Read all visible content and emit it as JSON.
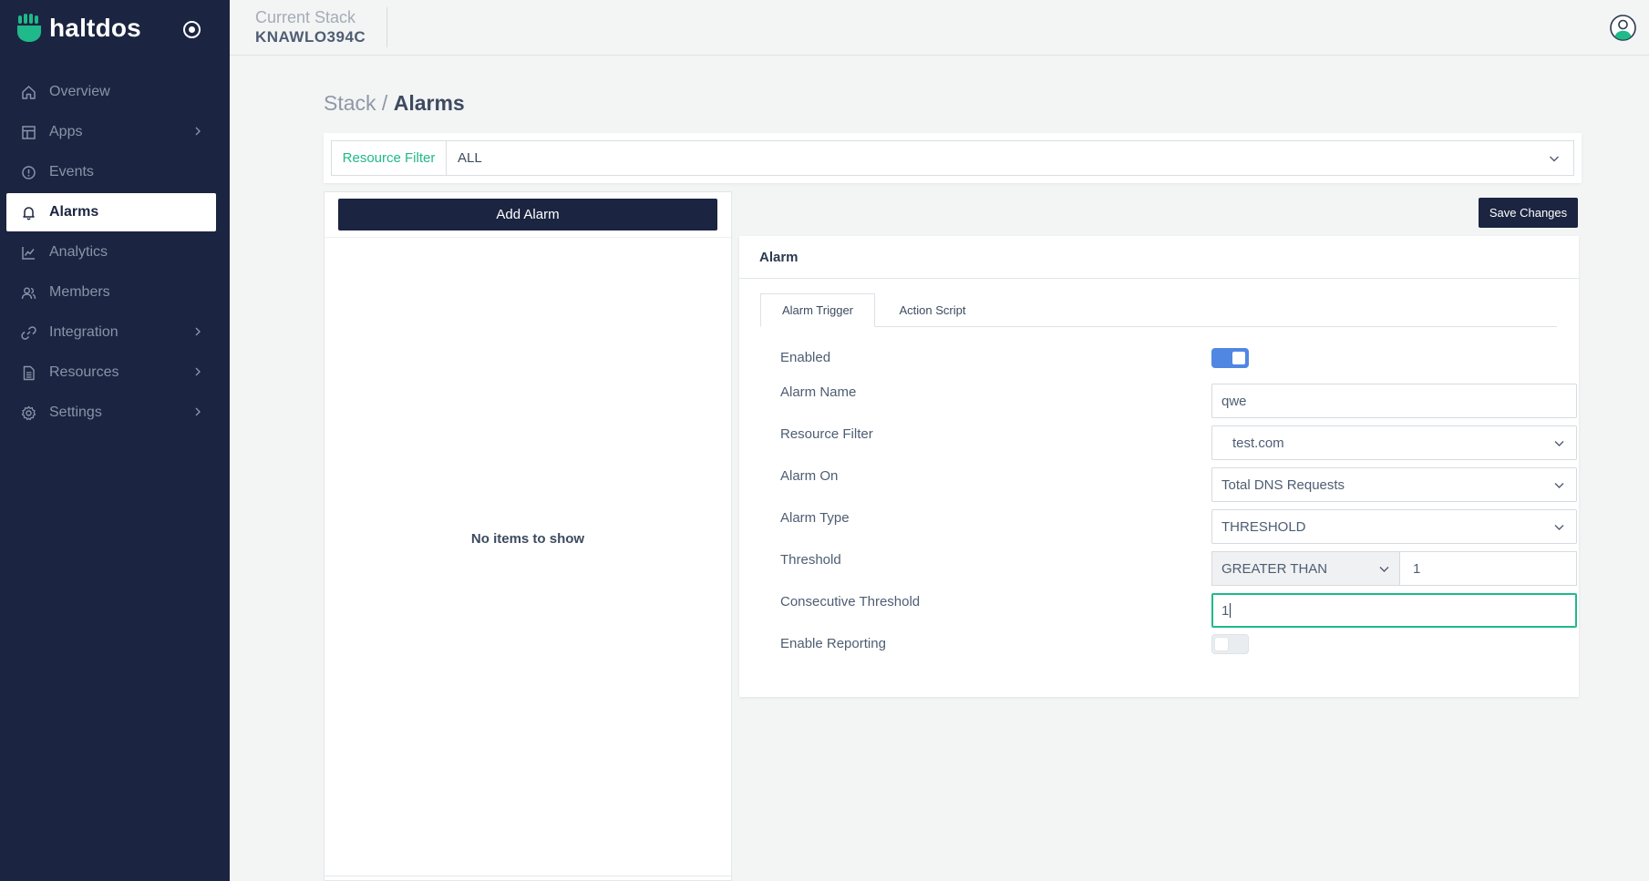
{
  "app": {
    "brand": "haltdos"
  },
  "sidebar": {
    "items": [
      {
        "label": "Overview",
        "icon": "home-icon",
        "has_chevron": false,
        "active": false
      },
      {
        "label": "Apps",
        "icon": "layout-icon",
        "has_chevron": true,
        "active": false
      },
      {
        "label": "Events",
        "icon": "info-circle-icon",
        "has_chevron": false,
        "active": false
      },
      {
        "label": "Alarms",
        "icon": "bell-icon",
        "has_chevron": false,
        "active": true
      },
      {
        "label": "Analytics",
        "icon": "line-chart-icon",
        "has_chevron": false,
        "active": false
      },
      {
        "label": "Members",
        "icon": "users-icon",
        "has_chevron": false,
        "active": false
      },
      {
        "label": "Integration",
        "icon": "link-icon",
        "has_chevron": true,
        "active": false
      },
      {
        "label": "Resources",
        "icon": "file-icon",
        "has_chevron": true,
        "active": false
      },
      {
        "label": "Settings",
        "icon": "gear-icon",
        "has_chevron": true,
        "active": false
      }
    ]
  },
  "header": {
    "stack_label": "Current Stack",
    "stack_value": "KNAWLO394C"
  },
  "breadcrumb": {
    "parent": "Stack",
    "separator": "/",
    "current": "Alarms"
  },
  "filter": {
    "label": "Resource Filter",
    "value": "ALL"
  },
  "list": {
    "add_button": "Add Alarm",
    "empty_text": "No items to show"
  },
  "toolbar": {
    "save_label": "Save Changes"
  },
  "alarm": {
    "title": "Alarm",
    "tabs": [
      {
        "label": "Alarm Trigger",
        "active": true
      },
      {
        "label": "Action Script",
        "active": false
      }
    ],
    "fields": {
      "enabled": {
        "label": "Enabled",
        "on": true
      },
      "name": {
        "label": "Alarm Name",
        "value": "qwe"
      },
      "resource_filter": {
        "label": "Resource Filter",
        "value": "test.com"
      },
      "alarm_on": {
        "label": "Alarm On",
        "value": "Total DNS Requests"
      },
      "alarm_type": {
        "label": "Alarm Type",
        "value": "THRESHOLD"
      },
      "threshold": {
        "label": "Threshold",
        "operator": "GREATER THAN",
        "value": "1"
      },
      "consecutive": {
        "label": "Consecutive Threshold",
        "value": "1"
      },
      "reporting": {
        "label": "Enable Reporting",
        "on": false
      }
    }
  },
  "colors": {
    "sidebar_bg": "#1b2541",
    "accent_green": "#1fb98a",
    "toggle_on": "#4f87e3",
    "page_bg": "#f3f4f4"
  }
}
